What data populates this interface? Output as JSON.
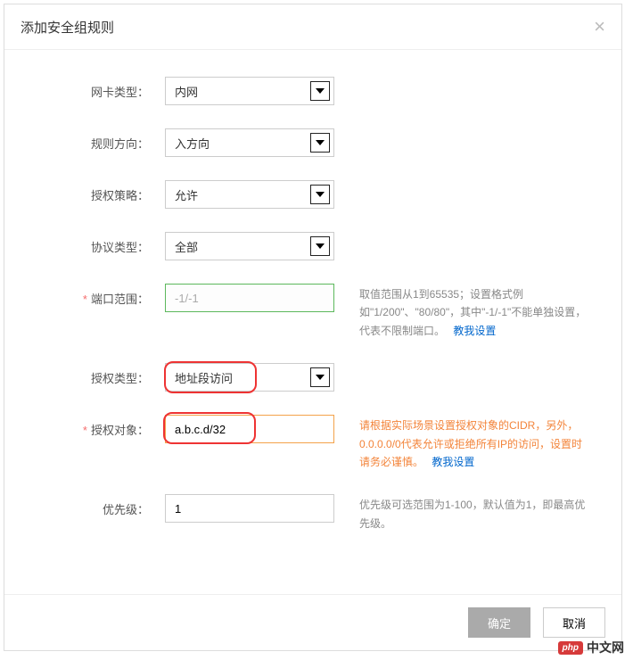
{
  "dialog": {
    "title": "添加安全组规则"
  },
  "form": {
    "nic_type": {
      "label": "网卡类型：",
      "value": "内网"
    },
    "direction": {
      "label": "规则方向：",
      "value": "入方向"
    },
    "policy": {
      "label": "授权策略：",
      "value": "允许"
    },
    "protocol": {
      "label": "协议类型：",
      "value": "全部"
    },
    "port_range": {
      "label": "端口范围：",
      "value": "-1/-1",
      "help": "取值范围从1到65535；设置格式例如\"1/200\"、\"80/80\"，其中\"-1/-1\"不能单独设置，代表不限制端口。",
      "help_link": "教我设置"
    },
    "auth_type": {
      "label": "授权类型：",
      "value": "地址段访问"
    },
    "auth_object": {
      "label": "授权对象：",
      "value": "a.b.c.d/32",
      "help": "请根据实际场景设置授权对象的CIDR，另外，0.0.0.0/0代表允许或拒绝所有IP的访问，设置时请务必谨慎。",
      "help_link": "教我设置"
    },
    "priority": {
      "label": "优先级：",
      "value": "1",
      "help": "优先级可选范围为1-100，默认值为1，即最高优先级。"
    }
  },
  "footer": {
    "ok": "确定",
    "cancel": "取消"
  },
  "watermark": {
    "logo": "php",
    "text": "中文网"
  }
}
